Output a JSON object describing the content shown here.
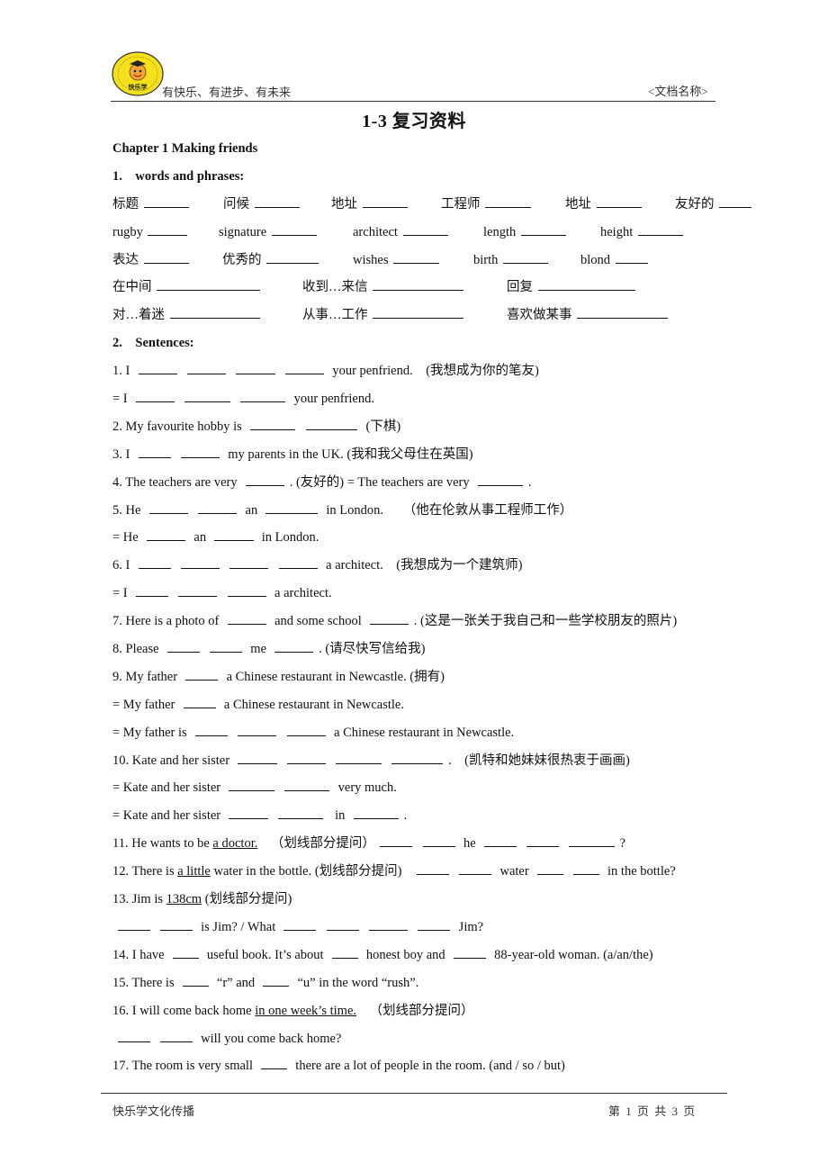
{
  "header": {
    "logo_text": "快乐学",
    "slogan": "有快乐、有进步、有未来",
    "doc_name": "<文档名称>"
  },
  "title": "1-3 复习资料",
  "chapter": "Chapter 1 Making friends",
  "section1": {
    "heading": "1.    words and phrases:",
    "rows": [
      [
        {
          "label": "标题",
          "blank": 7
        },
        {
          "label": "问候",
          "blank": 7
        },
        {
          "label": "地址",
          "blank": 7
        },
        {
          "label": "工程师",
          "blank": 7
        },
        {
          "label": "地址",
          "blank": 7
        },
        {
          "label": "友好的",
          "blank": 5
        }
      ],
      [
        {
          "label": "rugby",
          "blank": 6
        },
        {
          "label": "signature",
          "blank": 7
        },
        {
          "label": "architect",
          "blank": 7
        },
        {
          "label": "length",
          "blank": 7
        },
        {
          "label": "height",
          "blank": 7
        }
      ],
      [
        {
          "label": "表达",
          "blank": 7
        },
        {
          "label": "优秀的",
          "blank": 8
        },
        {
          "label": "wishes",
          "blank": 7
        },
        {
          "label": "birth",
          "blank": 7
        },
        {
          "label": "blond",
          "blank": 5
        }
      ],
      [
        {
          "label": "在中间",
          "blank": 16
        },
        {
          "label": "收到…来信",
          "blank": 14
        },
        {
          "label": "回复",
          "blank": 15
        }
      ],
      [
        {
          "label": "对…着迷",
          "blank": 14
        },
        {
          "label": "从事…工作",
          "blank": 14
        },
        {
          "label": "喜欢做某事",
          "blank": 14
        }
      ]
    ]
  },
  "section2": {
    "heading": "2.    Sentences:",
    "lines": [
      [
        {
          "t": "1. I "
        },
        {
          "b": 6
        },
        {
          "b": 6
        },
        {
          "b": 6
        },
        {
          "b": 6
        },
        {
          "t": " your penfriend.    (我想成为你的笔友)"
        }
      ],
      [
        {
          "t": "= I "
        },
        {
          "b": 6
        },
        {
          "b": 7
        },
        {
          "b": 7
        },
        {
          "t": " your penfriend."
        }
      ],
      [
        {
          "t": "2. My favourite hobby is "
        },
        {
          "b": 7
        },
        {
          "b": 8
        },
        {
          "t": " (下棋)"
        }
      ],
      [
        {
          "t": "3. I "
        },
        {
          "b": 5
        },
        {
          "b": 6
        },
        {
          "t": " my parents in the UK. (我和我父母住在英国)"
        }
      ],
      [
        {
          "t": "4. The teachers are very "
        },
        {
          "b": 6
        },
        {
          "t": ". (友好的) = The teachers are very "
        },
        {
          "b": 7
        },
        {
          "t": "."
        }
      ],
      [
        {
          "t": "5. He "
        },
        {
          "b": 6
        },
        {
          "b": 6
        },
        {
          "t": " an "
        },
        {
          "b": 8
        },
        {
          "t": " in London.      （他在伦敦从事工程师工作）"
        }
      ],
      [
        {
          "t": "= He "
        },
        {
          "b": 6
        },
        {
          "t": " an "
        },
        {
          "b": 6
        },
        {
          "t": " in London."
        }
      ],
      [
        {
          "t": "6. I "
        },
        {
          "b": 5
        },
        {
          "b": 6
        },
        {
          "b": 6
        },
        {
          "b": 6
        },
        {
          "t": " a architect.    (我想成为一个建筑师)"
        }
      ],
      [
        {
          "t": "= I "
        },
        {
          "b": 5
        },
        {
          "b": 6
        },
        {
          "b": 6
        },
        {
          "t": " a architect."
        }
      ],
      [
        {
          "t": "7. Here is a photo of "
        },
        {
          "b": 6
        },
        {
          "t": " and some school "
        },
        {
          "b": 6
        },
        {
          "t": ". (这是一张关于我自己和一些学校朋友的照片)"
        }
      ],
      [
        {
          "t": "8. Please "
        },
        {
          "b": 5
        },
        {
          "b": 5
        },
        {
          "t": " me "
        },
        {
          "b": 6
        },
        {
          "t": ". (请尽快写信给我)"
        }
      ],
      [
        {
          "t": "9. My father "
        },
        {
          "b": 5
        },
        {
          "t": " a Chinese restaurant in Newcastle. (拥有)"
        }
      ],
      [
        {
          "t": "= My father "
        },
        {
          "b": 5
        },
        {
          "t": " a Chinese restaurant in Newcastle."
        }
      ],
      [
        {
          "t": "= My father is "
        },
        {
          "b": 5
        },
        {
          "b": 6
        },
        {
          "b": 6
        },
        {
          "t": " a Chinese restaurant in Newcastle."
        }
      ],
      [
        {
          "t": "10. Kate and her sister "
        },
        {
          "b": 6
        },
        {
          "b": 6
        },
        {
          "b": 7
        },
        {
          "b": 8
        },
        {
          "t": ".    (凯特和她妹妹很热衷于画画)"
        }
      ],
      [
        {
          "t": "= Kate and her sister "
        },
        {
          "b": 7
        },
        {
          "b": 7
        },
        {
          "t": " very much."
        }
      ],
      [
        {
          "t": "= Kate and her sister "
        },
        {
          "b": 6
        },
        {
          "b": 7
        },
        {
          "t": "  in "
        },
        {
          "b": 7
        },
        {
          "t": "."
        }
      ],
      [
        {
          "t": "11. He wants to be "
        },
        {
          "u": "a doctor."
        },
        {
          "t": "    （划线部分提问）"
        },
        {
          "b": 5
        },
        {
          "b": 5
        },
        {
          "t": " he "
        },
        {
          "b": 5
        },
        {
          "b": 5
        },
        {
          "b": 7
        },
        {
          "t": "?"
        }
      ],
      [
        {
          "t": "12. There is "
        },
        {
          "u": "a little"
        },
        {
          "t": " water in the bottle. (划线部分提问)   "
        },
        {
          "b": 5
        },
        {
          "b": 5
        },
        {
          "t": " water "
        },
        {
          "b": 4
        },
        {
          "b": 4
        },
        {
          "t": " in the bottle?"
        }
      ],
      [
        {
          "t": "13. Jim is "
        },
        {
          "u": "138cm"
        },
        {
          "t": " (划线部分提问)"
        }
      ],
      [
        {
          "b": 5
        },
        {
          "b": 5
        },
        {
          "t": " is Jim? / What "
        },
        {
          "b": 5
        },
        {
          "b": 5
        },
        {
          "b": 6
        },
        {
          "b": 5
        },
        {
          "t": " Jim?"
        }
      ],
      [
        {
          "t": "14. I have "
        },
        {
          "b": 4
        },
        {
          "t": " useful book. It’s about "
        },
        {
          "b": 4
        },
        {
          "t": " honest boy and "
        },
        {
          "b": 5
        },
        {
          "t": " 88-year-old woman. (a/an/the)"
        }
      ],
      [
        {
          "t": "15. There is "
        },
        {
          "b": 4
        },
        {
          "t": " “r” and "
        },
        {
          "b": 4
        },
        {
          "t": " “u” in the word “rush”."
        }
      ],
      [
        {
          "t": "16. I will come back home "
        },
        {
          "u": "in one week’s time."
        },
        {
          "t": "    （划线部分提问）"
        }
      ],
      [
        {
          "b": 5
        },
        {
          "b": 5
        },
        {
          "t": " will you come back home?"
        }
      ],
      [
        {
          "t": "17. The room is very small "
        },
        {
          "b": 4
        },
        {
          "t": " there are a lot of people in the room. (and / so / but)"
        }
      ]
    ]
  },
  "footer": {
    "left": "快乐学文化传播",
    "page_text": "第 1 页 共 3 页",
    "current_page": 1,
    "total_pages": 3
  }
}
